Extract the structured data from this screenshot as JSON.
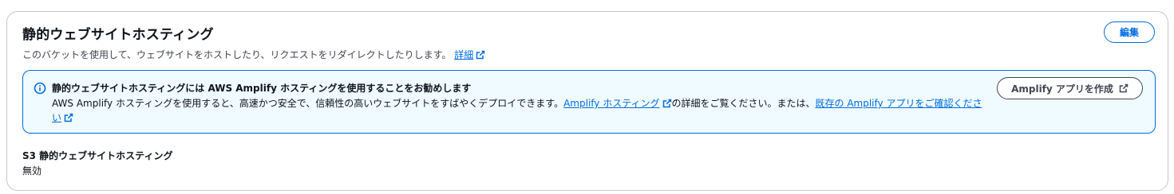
{
  "panel": {
    "title": "静的ウェブサイトホスティング",
    "description": "このバケットを使用して、ウェブサイトをホストしたり、リクエストをリダイレクトしたりします。",
    "info_link": "詳細",
    "edit_button": "編集"
  },
  "alert": {
    "header": "静的ウェブサイトホスティングには AWS Amplify ホスティングを使用することをお勧めします",
    "body_part1": "AWS Amplify ホスティングを使用すると、高速かつ安全で、信頼性の高いウェブサイトをすばやくデプロイできます。",
    "link_amplify_hosting": "Amplify ホスティング",
    "body_part2": "の詳細をご覧ください。または、",
    "link_existing_app": "既存の Amplify アプリをご確認ください",
    "create_button": "Amplify アプリを作成"
  },
  "setting": {
    "label": "S3 静的ウェブサイトホスティング",
    "value": "無効"
  },
  "colors": {
    "link": "#006ce0",
    "alert_border": "#006ce0",
    "alert_background": "#f0fbff",
    "panel_border": "#c6c6cd"
  },
  "icons": {
    "alert": "info-circle-icon",
    "external": "external-link-icon"
  }
}
